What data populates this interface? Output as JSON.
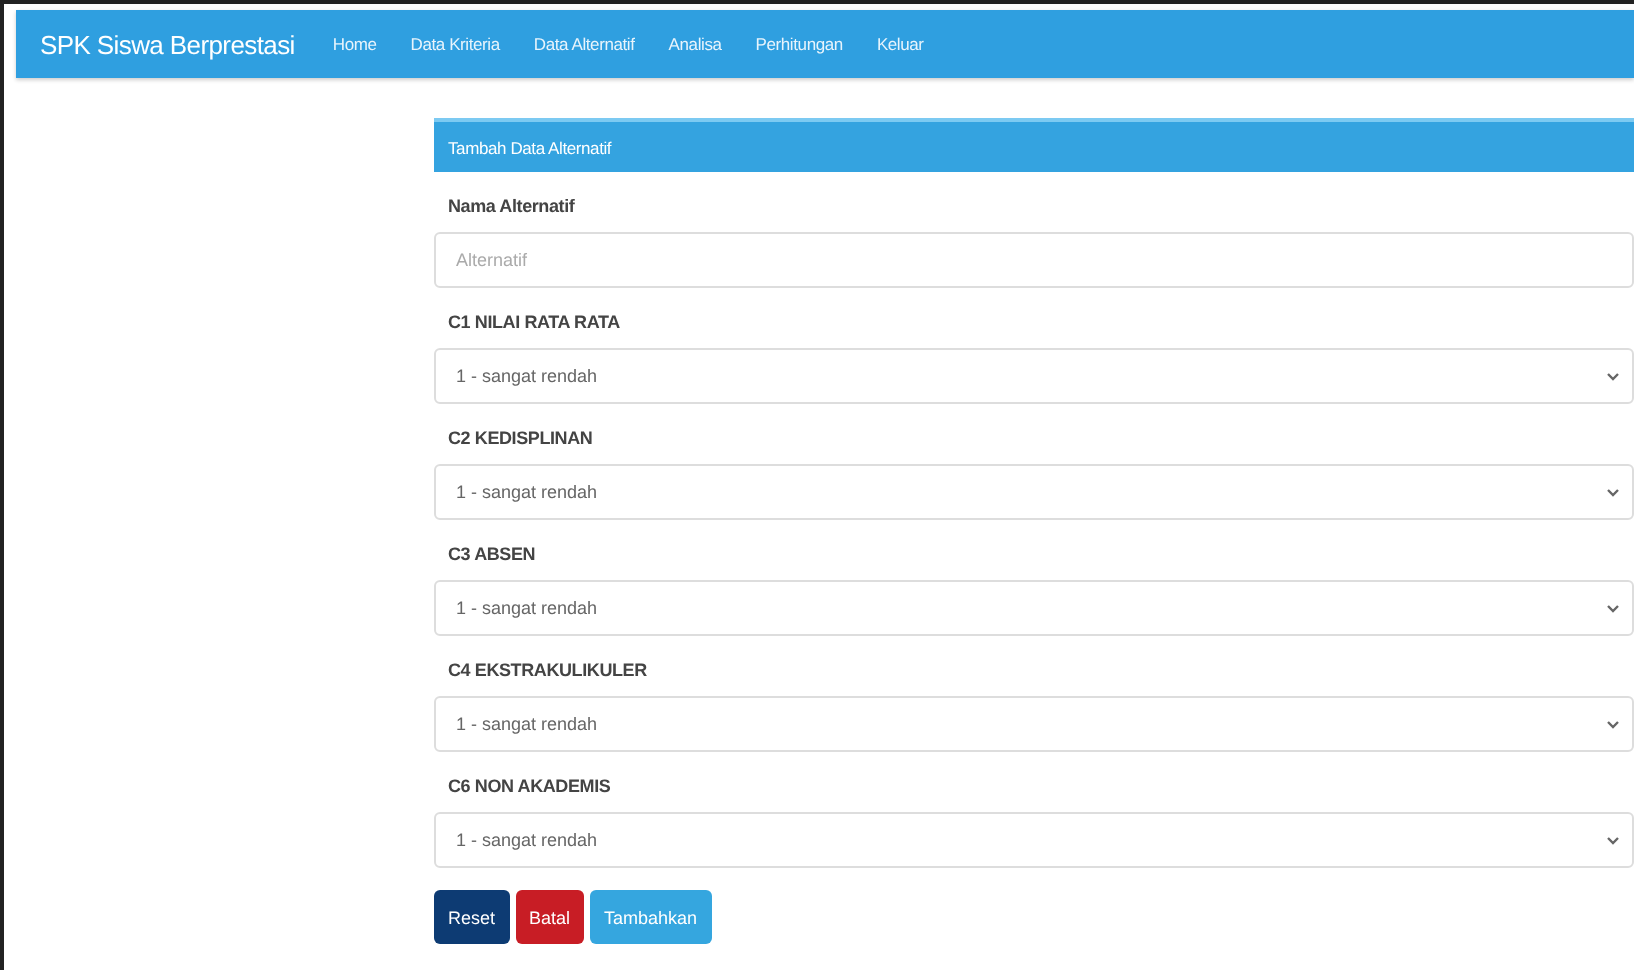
{
  "navbar": {
    "brand": "SPK Siswa Berprestasi",
    "items": [
      "Home",
      "Data Kriteria",
      "Data Alternatif",
      "Analisa",
      "Perhitungan",
      "Keluar"
    ]
  },
  "panel": {
    "title": "Tambah Data Alternatif",
    "fields": [
      {
        "kind": "text",
        "label": "Nama Alternatif",
        "placeholder": "Alternatif"
      },
      {
        "kind": "select",
        "label": "C1 NILAI RATA RATA",
        "value": "1 - sangat rendah"
      },
      {
        "kind": "select",
        "label": "C2 KEDISPLINAN",
        "value": "1 - sangat rendah"
      },
      {
        "kind": "select",
        "label": "C3 ABSEN",
        "value": "1 - sangat rendah"
      },
      {
        "kind": "select",
        "label": "C4 EKSTRAKULIKULER",
        "value": "1 - sangat rendah"
      },
      {
        "kind": "select",
        "label": "C6 NON AKADEMIS",
        "value": "1 - sangat rendah"
      }
    ],
    "buttons": [
      {
        "kind": "primary",
        "label": "Reset"
      },
      {
        "kind": "danger",
        "label": "Batal"
      },
      {
        "kind": "info",
        "label": "Tambahkan"
      }
    ]
  }
}
